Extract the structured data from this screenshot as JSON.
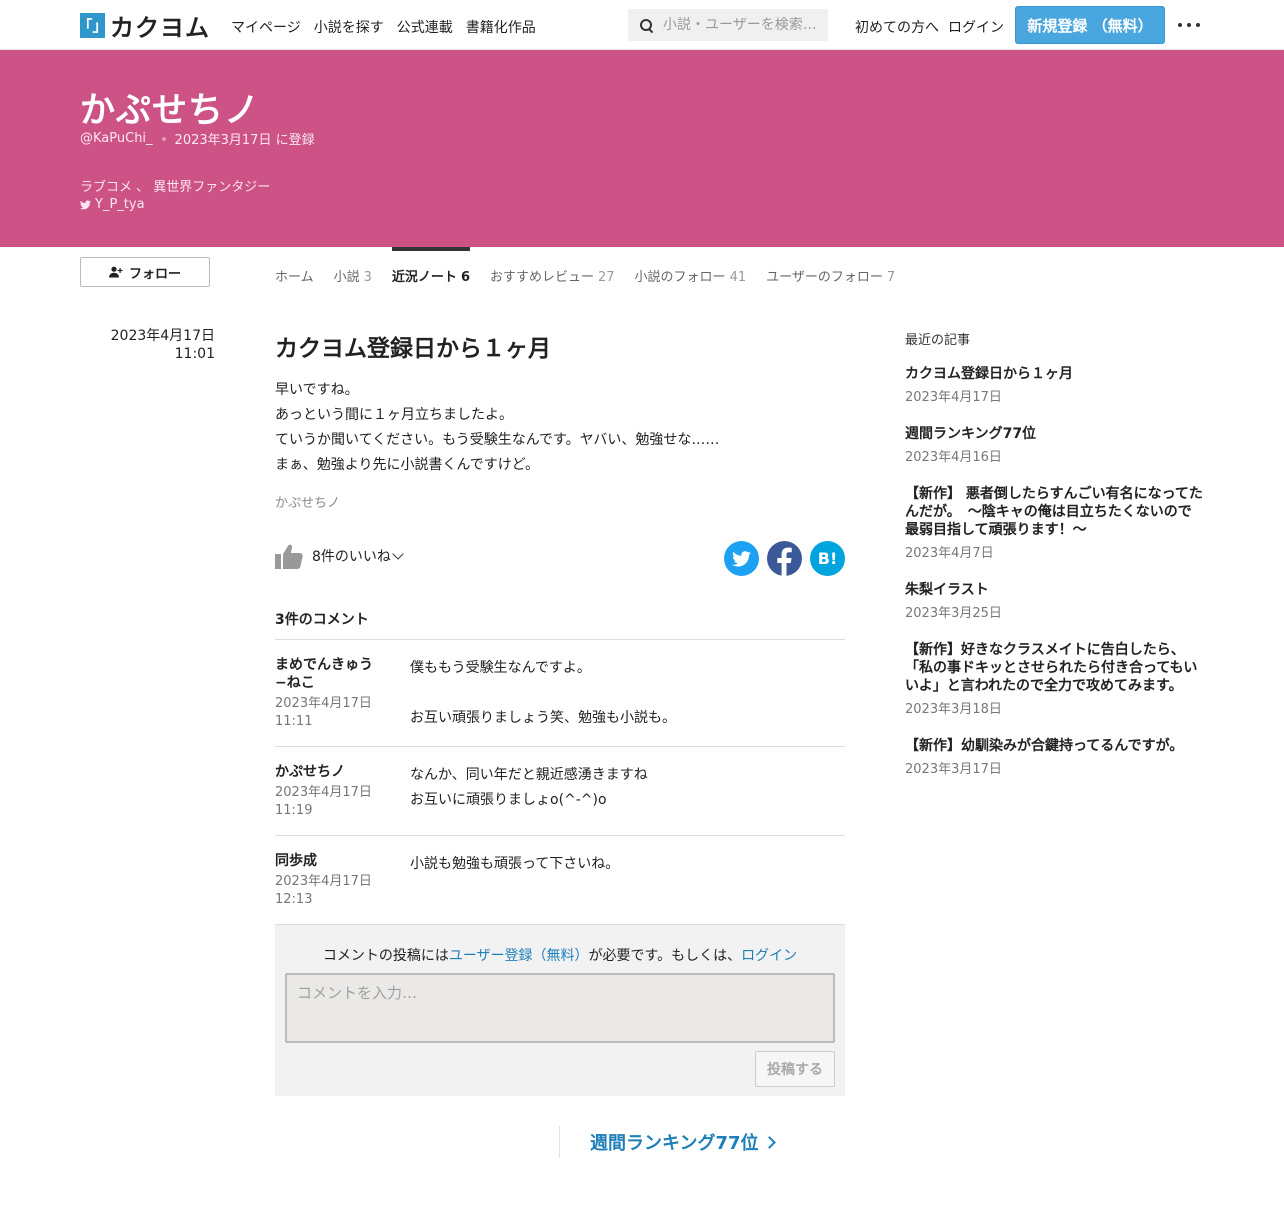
{
  "header": {
    "logo_mark": "「」",
    "logo_text": "カクヨム",
    "nav": [
      "マイページ",
      "小説を探す",
      "公式連載",
      "書籍化作品"
    ],
    "search_placeholder": "小説・ユーザーを検索…",
    "first_time": "初めての方へ",
    "login": "ログイン",
    "register": "新規登録 （無料）",
    "colors": {
      "register_button": "#4aa6de",
      "banner": "#cd5387",
      "link": "#1f7fb9"
    }
  },
  "profile": {
    "name": "かぷせちノ",
    "handle": "@KaPuChi_",
    "registered": "2023年3月17日 に登録",
    "genres": "ラブコメ 、 異世界ファンタジー",
    "twitter": "Y_P_tya",
    "follow_label": "フォロー"
  },
  "tabs": [
    {
      "label": "ホーム",
      "count": ""
    },
    {
      "label": "小説",
      "count": "3"
    },
    {
      "label": "近況ノート",
      "count": "6"
    },
    {
      "label": "おすすめレビュー",
      "count": "27"
    },
    {
      "label": "小説のフォロー",
      "count": "41"
    },
    {
      "label": "ユーザーのフォロー",
      "count": "7"
    }
  ],
  "post": {
    "date": "2023年4月17日",
    "time": "11:01",
    "title": "カクヨム登録日から１ヶ月",
    "body": [
      "早いですね。",
      "あっという間に１ヶ月立ちましたよ。",
      "ていうか聞いてください。もう受験生なんです。ヤバい、勉強せな……",
      "まぁ、勉強より先に小説書くんですけど。"
    ],
    "signature": "かぷせちノ",
    "likes": "8件のいいね",
    "share_icons": [
      "twitter-icon",
      "facebook-icon",
      "hatena-bookmark-icon"
    ],
    "hatena_label": "B!"
  },
  "comments": {
    "heading": "3件のコメント",
    "items": [
      {
        "user": "まめでんきゅう−ねこ",
        "date": "2023年4月17日",
        "time": "11:11",
        "lines": [
          "僕ももう受験生なんですよ。",
          "",
          "お互い頑張りましょう笑、勉強も小説も。"
        ]
      },
      {
        "user": "かぷせちノ",
        "date": "2023年4月17日",
        "time": "11:19",
        "lines": [
          "なんか、同い年だと親近感湧きますね",
          "お互いに頑張りましょo(^-^)o"
        ]
      },
      {
        "user": "同歩成",
        "date": "2023年4月17日",
        "time": "12:13",
        "lines": [
          "小説も勉強も頑張って下さいね。"
        ]
      }
    ],
    "form": {
      "note_before": "コメントの投稿には",
      "note_link_register": "ユーザー登録（無料）",
      "note_middle": "が必要です。もしくは、",
      "note_link_login": "ログイン",
      "placeholder": "コメントを入力…",
      "submit": "投稿する"
    }
  },
  "next_post": "週間ランキング77位",
  "sidebar": {
    "heading": "最近の記事",
    "items": [
      {
        "title": "カクヨム登録日から１ヶ月",
        "date": "2023年4月17日"
      },
      {
        "title": "週間ランキング77位",
        "date": "2023年4月16日"
      },
      {
        "title": "【新作】 悪者倒したらすんごい有名になってたんだが。　～陰キャの俺は目立ちたくないので最弱目指して頑張ります！～",
        "date": "2023年4月7日"
      },
      {
        "title": "朱梨イラスト",
        "date": "2023年3月25日"
      },
      {
        "title": "【新作】好きなクラスメイトに告白したら、「私の事ドキッとさせられたら付き合ってもいいよ」と言われたので全力で攻めてみます。",
        "date": "2023年3月18日"
      },
      {
        "title": "【新作】幼馴染みが合鍵持ってるんですが。",
        "date": "2023年3月17日"
      }
    ]
  }
}
